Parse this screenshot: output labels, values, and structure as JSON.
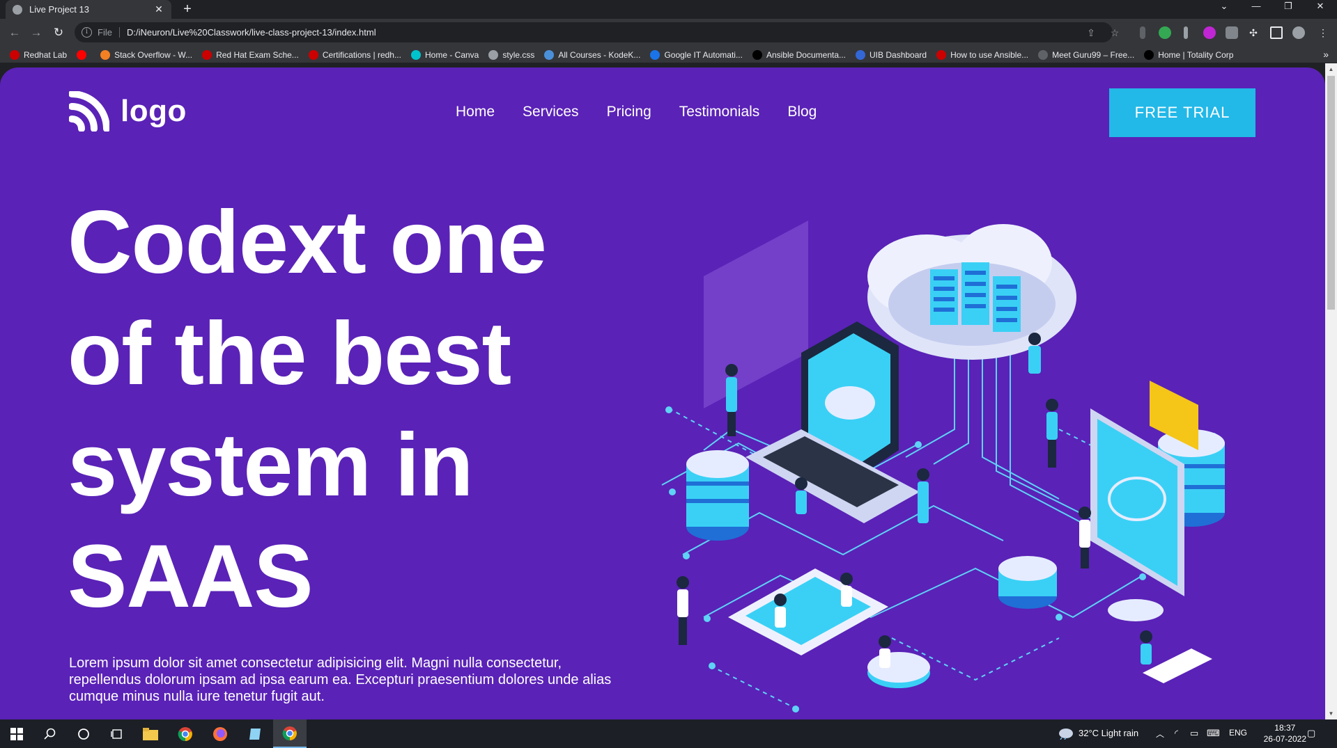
{
  "browser": {
    "tab_title": "Live Project 13",
    "tab_close": "✕",
    "new_tab": "+",
    "url_scheme": "File",
    "url": "D:/iNeuron/Live%20Classwork/live-class-project-13/index.html",
    "bookmarks": [
      {
        "label": "Redhat Lab",
        "color": "#cc0000"
      },
      {
        "label": "",
        "color": "#ff0000"
      },
      {
        "label": "Stack Overflow - W...",
        "color": "#f48024"
      },
      {
        "label": "Red Hat Exam Sche...",
        "color": "#cc0000"
      },
      {
        "label": "Certifications | redh...",
        "color": "#cc0000"
      },
      {
        "label": "Home - Canva",
        "color": "#00c4cc"
      },
      {
        "label": "style.css",
        "color": "#9aa0a6"
      },
      {
        "label": "All Courses - KodeK...",
        "color": "#4a90d9"
      },
      {
        "label": "Google IT Automati...",
        "color": "#1a73e8"
      },
      {
        "label": "Ansible Documenta...",
        "color": "#000000"
      },
      {
        "label": "UIB Dashboard",
        "color": "#3367d6"
      },
      {
        "label": "How to use Ansible...",
        "color": "#cc0000"
      },
      {
        "label": "Meet Guru99 – Free...",
        "color": "#5f6368"
      },
      {
        "label": "Home | Totality Corp",
        "color": "#000000"
      }
    ],
    "bookmarks_more": "»"
  },
  "page": {
    "logo_text": "logo",
    "nav": [
      "Home",
      "Services",
      "Pricing",
      "Testimonials",
      "Blog"
    ],
    "cta_label": "FREE TRIAL",
    "hero_title_lines": [
      "Codext one",
      "of the best",
      "system in",
      "SAAS"
    ],
    "hero_description": "Lorem ipsum dolor sit amet consectetur adipisicing elit. Magni nulla consectetur, repellendus dolorum ipsam ad ipsa earum ea. Excepturi praesentium dolores unde alias cumque minus nulla iure tenetur fugit aut.",
    "colors": {
      "background": "#5a22b7",
      "accent": "#22b8e8",
      "text": "#ffffff"
    }
  },
  "taskbar": {
    "weather": "32°C  Light rain",
    "language": "ENG",
    "time": "18:37",
    "date": "26-07-2022",
    "apps": [
      "windows-start",
      "search",
      "cortana",
      "task-view",
      "file-explorer",
      "chrome",
      "firefox",
      "notepad",
      "chrome-active"
    ]
  }
}
